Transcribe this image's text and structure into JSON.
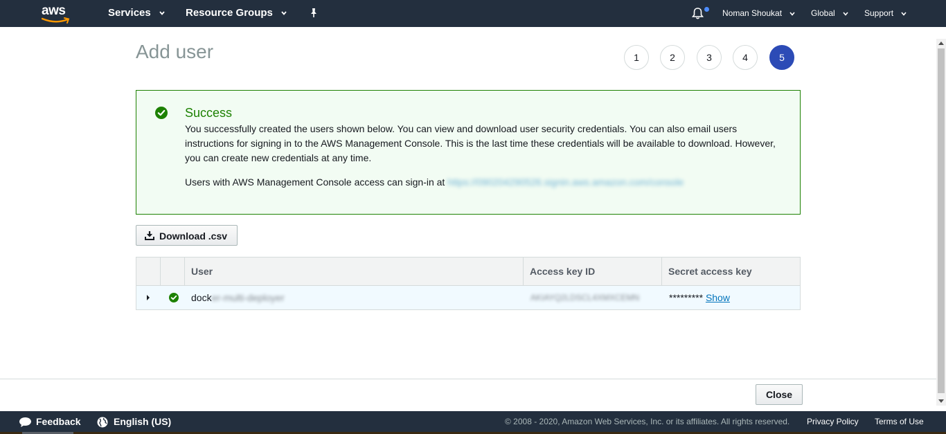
{
  "nav": {
    "logo_text": "aws",
    "services": "Services",
    "resource_groups": "Resource Groups",
    "user": "Noman Shoukat",
    "region": "Global",
    "support": "Support"
  },
  "page": {
    "title": "Add user",
    "steps": [
      "1",
      "2",
      "3",
      "4",
      "5"
    ],
    "active_step": 5
  },
  "success": {
    "title": "Success",
    "message": "You successfully created the users shown below. You can view and download user security credentials. You can also email users instructions for signing in to the AWS Management Console. This is the last time these credentials will be available to download. However, you can create new credentials at any time.",
    "signin_prefix": "Users with AWS Management Console access can sign-in at",
    "signin_url": "https://090204290526.signin.aws.amazon.com/console"
  },
  "download_label": "Download .csv",
  "table": {
    "headers": {
      "user": "User",
      "access_key": "Access key ID",
      "secret": "Secret access key"
    },
    "row": {
      "user_visible": "dock",
      "user_hidden": "er-multi-deployer",
      "access_key": "AKIAYQ2LDSCL4XMXCEMN",
      "secret_masked": "*********",
      "show_label": "Show"
    }
  },
  "close_label": "Close",
  "footer": {
    "feedback": "Feedback",
    "language": "English (US)",
    "copyright": "© 2008 - 2020, Amazon Web Services, Inc. or its affiliates. All rights reserved.",
    "privacy": "Privacy Policy",
    "terms": "Terms of Use"
  },
  "colors": {
    "nav_bg": "#232f3e",
    "success_green": "#1d8102",
    "success_bg": "#f2fcf3",
    "active_step": "#2c4bb6",
    "link": "#0073bb"
  }
}
